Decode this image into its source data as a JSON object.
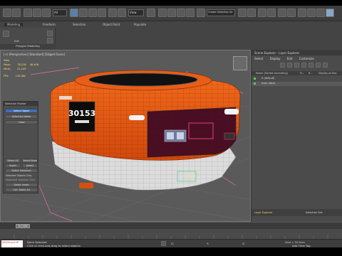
{
  "toolbar": {
    "filter_all": "All",
    "view": "View",
    "selection_set": "Create Selection Se",
    "tabs": [
      "Modeling",
      "Freeform",
      "Selection",
      "Object Paint",
      "Populate"
    ]
  },
  "ribbon": {
    "edit": "Edit",
    "title": "Polygon Modeling"
  },
  "viewport": {
    "label": "[+] [Perspective] [Standard] [Edged Faces]",
    "stats": [
      {
        "name": "Total",
        "v1": "",
        "v2": ""
      },
      {
        "name": "Polys:",
        "v1": "76,218",
        "v2": "48,406"
      },
      {
        "name": "Verts:",
        "v1": "41,149",
        "v2": ""
      },
      {
        "name": "FPS:",
        "v1": "130.062",
        "v2": ""
      }
    ],
    "robot_number": "30153"
  },
  "floater": {
    "title": "Selection Floater",
    "items": [
      "Select Object",
      "Select by Name",
      "Close",
      "Select All",
      "Select None",
      "Invert",
      "Select Similar",
      "Select Instances",
      "Select Invert"
    ],
    "options": [
      "Selected Objects Only",
      "Displayed Selection Only",
      "Ctrl: Select All"
    ]
  },
  "scene_explorer": {
    "title": "Scene Explorer - Layer Explorer",
    "menu": [
      "Select",
      "Display",
      "Edit",
      "Customize"
    ],
    "col_name": "Name (Sorted Ascending)",
    "col_frozen": "Fr...",
    "col_r": "R...",
    "col_display": "Display as Box",
    "rows": [
      "0 (default)",
      "Scan robot"
    ],
    "footer": "Layer Explorer",
    "footer_sel": "Selection Set:"
  },
  "timeline": {
    "frame": "0 / 100"
  },
  "status": {
    "selected": "None Selected",
    "hint": "Click or click-and-drag to select objects",
    "x": "X:",
    "y": "Y:",
    "z": "Z:",
    "grid": "Grid = 10.0cm",
    "add_time_tag": "Add Time Tag",
    "maxscript": "MAXScript Mi"
  }
}
